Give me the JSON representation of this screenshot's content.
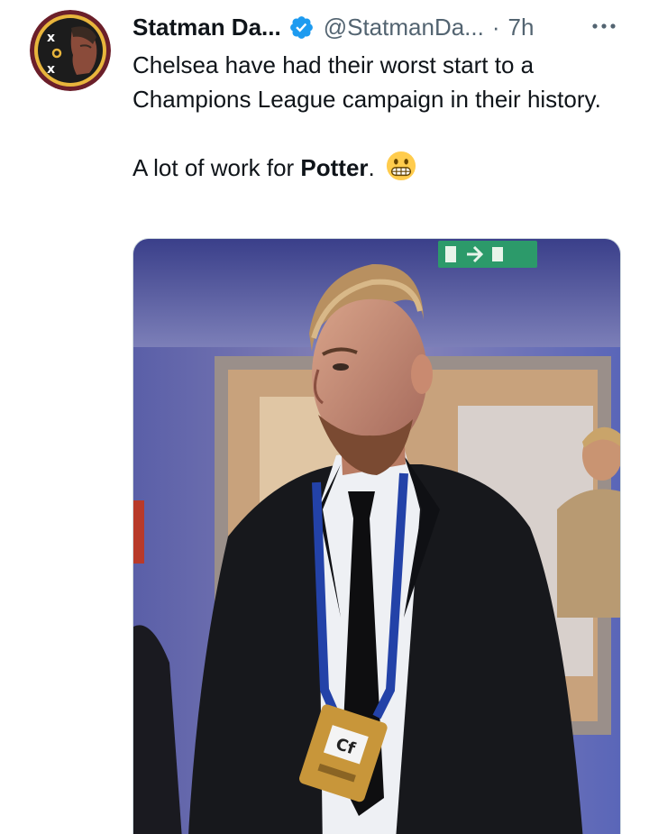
{
  "tweet": {
    "author": {
      "display_name": "Statman Da...",
      "handle": "@StatmanDa...",
      "verified": true,
      "avatar_icon": "tactics-board-avatar-icon"
    },
    "separator": "·",
    "timestamp": "7h",
    "more_icon": "more-horizontal-icon",
    "text": {
      "line1": "Chelsea have had their worst start to a Champions League campaign in their history.",
      "line2_before": "A lot of work for ",
      "line2_bold": "Potter",
      "line2_after": ".",
      "emoji": "grimacing-face-emoji"
    },
    "media": {
      "kind": "photo",
      "description_icon": "photo-man-in-suit-with-lanyard",
      "badge_text": "Cf"
    }
  },
  "colors": {
    "text_primary": "#0f1419",
    "text_secondary": "#536471",
    "verified_blue": "#1d9bf0",
    "border": "#cfd9de"
  }
}
